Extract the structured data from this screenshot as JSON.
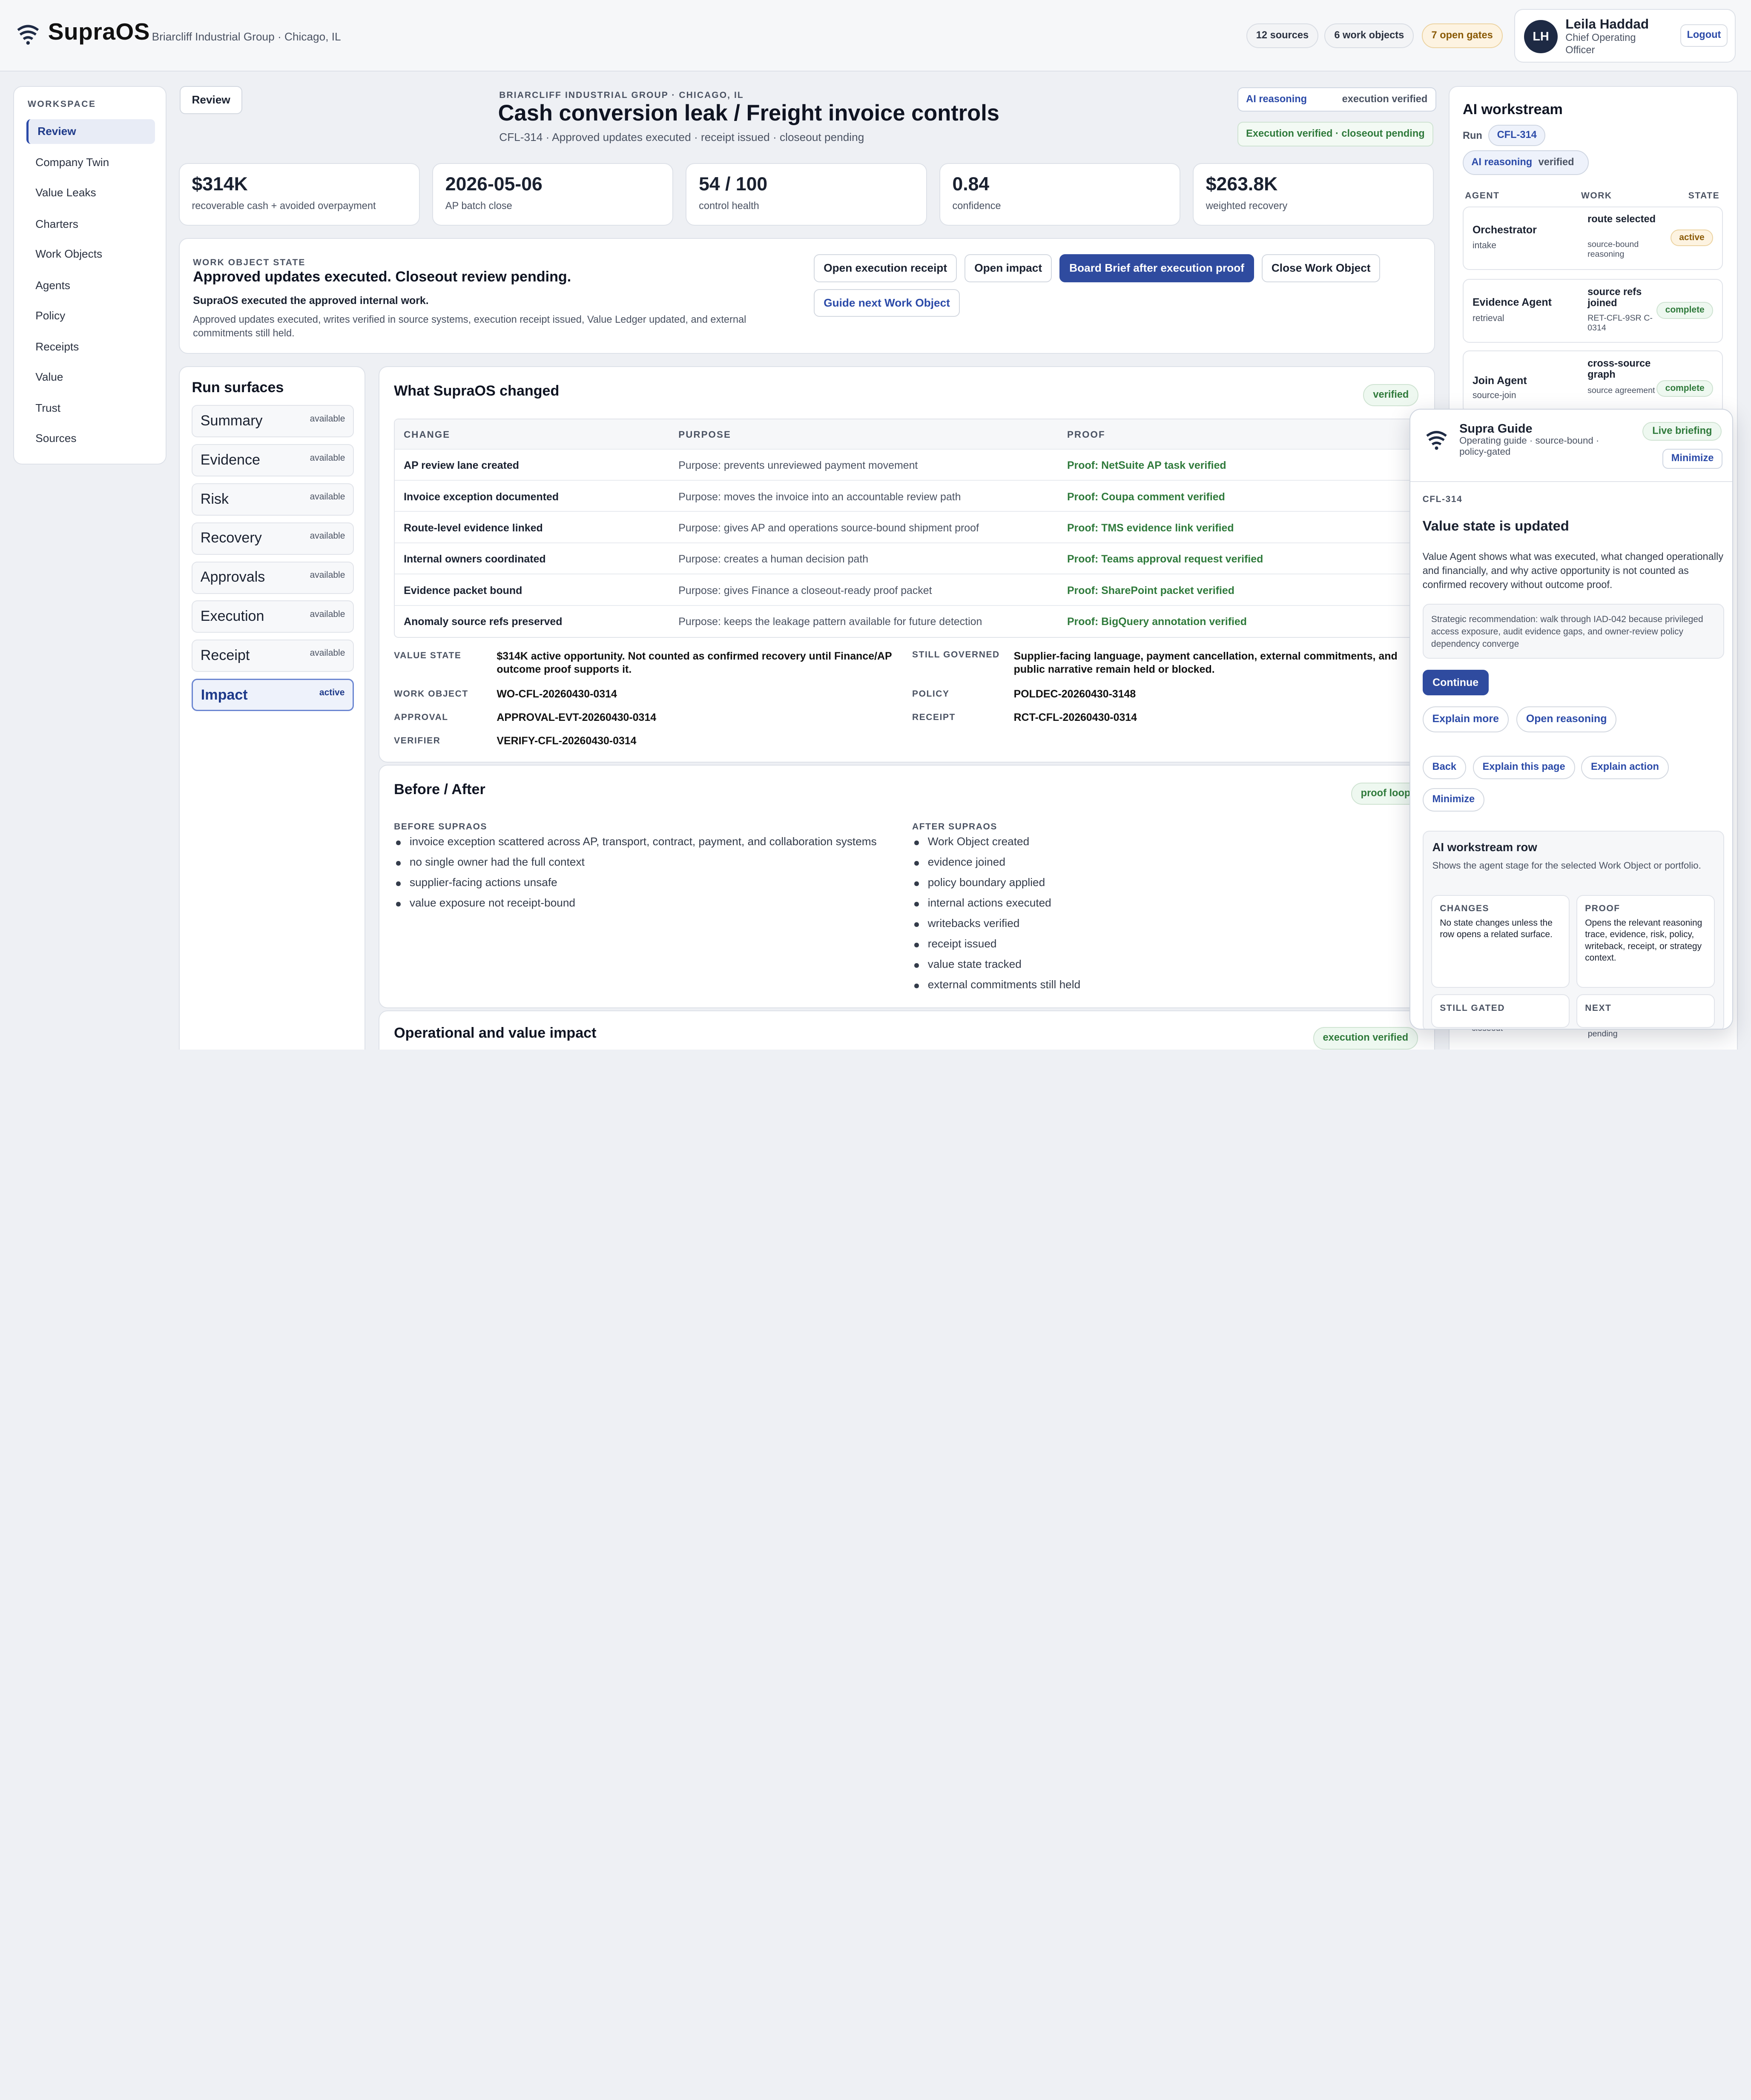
{
  "app": {
    "brand": "SupraOS",
    "tenant": "Briarcliff Industrial Group · Chicago, IL",
    "pills": [
      "12 sources",
      "6 work objects",
      "7 open gates"
    ],
    "user": {
      "initials": "LH",
      "name": "Leila Haddad",
      "role": "Chief Operating Officer",
      "logout": "Logout"
    }
  },
  "sidebar": {
    "heading": "WORKSPACE",
    "items": [
      "Review",
      "Company Twin",
      "Value Leaks",
      "Charters",
      "Work Objects",
      "Agents",
      "Policy",
      "Receipts",
      "Value",
      "Trust",
      "Sources"
    ],
    "active": "Review"
  },
  "header": {
    "review_button": "Review",
    "eyebrow": "BRIARCLIFF INDUSTRIAL GROUP · CHICAGO, IL",
    "title": "Cash conversion leak / Freight invoice controls",
    "subtitle": "CFL-314 · Approved updates executed · receipt issued · closeout pending",
    "tag_ai": "AI reasoning",
    "tag_exec": "execution verified",
    "tag_closeout": "Execution verified · closeout pending"
  },
  "kpis": [
    {
      "value": "$314K",
      "label": "recoverable cash + avoided overpayment"
    },
    {
      "value": "2026-05-06",
      "label": "AP batch close"
    },
    {
      "value": "54 / 100",
      "label": "control health"
    },
    {
      "value": "0.84",
      "label": "confidence"
    },
    {
      "value": "$263.8K",
      "label": "weighted recovery"
    }
  ],
  "work_object_state": {
    "eyebrow": "WORK OBJECT STATE",
    "title": "Approved updates executed. Closeout review pending.",
    "lead": "SupraOS executed the approved internal work.",
    "body": "Approved updates executed, writes verified in source systems, execution receipt issued, Value Ledger updated, and external commitments still held.",
    "buttons": {
      "open_receipt": "Open execution receipt",
      "open_impact": "Open impact",
      "board_brief": "Board Brief after execution proof",
      "close_wo": "Close Work Object",
      "guide_next": "Guide next Work Object"
    }
  },
  "run_surfaces": {
    "title": "Run surfaces",
    "items": [
      {
        "name": "Summary",
        "status": "available"
      },
      {
        "name": "Evidence",
        "status": "available"
      },
      {
        "name": "Risk",
        "status": "available"
      },
      {
        "name": "Recovery",
        "status": "available"
      },
      {
        "name": "Approvals",
        "status": "available"
      },
      {
        "name": "Execution",
        "status": "available"
      },
      {
        "name": "Receipt",
        "status": "available"
      },
      {
        "name": "Impact",
        "status": "active"
      }
    ]
  },
  "changed": {
    "title": "What SupraOS changed",
    "badge": "verified",
    "columns": [
      "CHANGE",
      "PURPOSE",
      "PROOF"
    ],
    "rows": [
      {
        "change": "AP review lane created",
        "purpose": "Purpose: prevents unreviewed payment movement",
        "proof": "Proof: NetSuite AP task verified"
      },
      {
        "change": "Invoice exception documented",
        "purpose": "Purpose: moves the invoice into an accountable review path",
        "proof": "Proof: Coupa comment verified"
      },
      {
        "change": "Route-level evidence linked",
        "purpose": "Purpose: gives AP and operations source-bound shipment proof",
        "proof": "Proof: TMS evidence link verified"
      },
      {
        "change": "Internal owners coordinated",
        "purpose": "Purpose: creates a human decision path",
        "proof": "Proof: Teams approval request verified"
      },
      {
        "change": "Evidence packet bound",
        "purpose": "Purpose: gives Finance a closeout-ready proof packet",
        "proof": "Proof: SharePoint packet verified"
      },
      {
        "change": "Anomaly source refs preserved",
        "purpose": "Purpose: keeps the leakage pattern available for future detection",
        "proof": "Proof: BigQuery annotation verified"
      }
    ],
    "kv": {
      "value_state_k": "VALUE STATE",
      "value_state_v": "$314K active opportunity. Not counted as confirmed recovery until Finance/AP outcome proof supports it.",
      "still_governed_k": "STILL GOVERNED",
      "still_governed_v": "Supplier-facing language, payment cancellation, external commitments, and public narrative remain held or blocked.",
      "work_object_k": "WORK OBJECT",
      "work_object_v": "WO-CFL-20260430-0314",
      "policy_k": "POLICY",
      "policy_v": "POLDEC-20260430-3148",
      "approval_k": "APPROVAL",
      "approval_v": "APPROVAL-EVT-20260430-0314",
      "receipt_k": "RECEIPT",
      "receipt_v": "RCT-CFL-20260430-0314",
      "verifier_k": "VERIFIER",
      "verifier_v": "VERIFY-CFL-20260430-0314"
    }
  },
  "before_after": {
    "title": "Before / After",
    "badge": "proof loop",
    "before_label": "BEFORE SUPRAOS",
    "before": [
      "invoice exception scattered across AP, transport, contract, payment, and collaboration systems",
      "no single owner had the full context",
      "supplier-facing actions unsafe",
      "value exposure not receipt-bound"
    ],
    "after_label": "AFTER SUPRAOS",
    "after": [
      "Work Object created",
      "evidence joined",
      "policy boundary applied",
      "internal actions executed",
      "writebacks verified",
      "receipt issued",
      "value state tracked",
      "external commitments still held"
    ]
  },
  "operational": {
    "title": "Operational and value impact",
    "badge": "execution verified"
  },
  "ai_workstream": {
    "title": "AI workstream",
    "run_label": "Run",
    "run_id": "CFL-314",
    "reasoning_label": "AI reasoning",
    "reasoning_state": "verified",
    "columns": [
      "AGENT",
      "WORK",
      "STATE"
    ],
    "agents": [
      {
        "name": "Orchestrator",
        "role": "intake",
        "work": "route selected",
        "detail": "source-bound reasoning",
        "state": "active"
      },
      {
        "name": "Evidence Agent",
        "role": "retrieval",
        "work": "source refs joined",
        "detail": "RET-CFL-9SR C-0314",
        "state": "complete"
      },
      {
        "name": "Join Agent",
        "role": "source-join",
        "work": "cross-source graph",
        "detail": "source agreement",
        "state": "complete"
      }
    ],
    "peek_left": "closeout",
    "peek_right": "pending"
  },
  "guide": {
    "title": "Supra Guide",
    "subtitle": "Operating guide · source-bound · policy-gated",
    "live": "Live briefing",
    "minimize": "Minimize",
    "run_id": "CFL-314",
    "heading": "Value state is updated",
    "body": "Value Agent shows what was executed, what changed operationally and financially, and why active opportunity is not counted as confirmed recovery without outcome proof.",
    "recommendation": "Strategic recommendation: walk through IAD-042 because privileged access exposure, audit evidence gaps, and owner-review policy dependency converge",
    "continue": "Continue",
    "explain_more": "Explain more",
    "open_reasoning": "Open reasoning",
    "back": "Back",
    "explain_page": "Explain this page",
    "explain_action": "Explain action",
    "minimize2": "Minimize",
    "row_title": "AI workstream row",
    "row_desc": "Shows the agent stage for the selected Work Object or portfolio.",
    "changes_k": "CHANGES",
    "changes_v": "No state changes unless the row opens a related surface.",
    "proof_k": "PROOF",
    "proof_v": "Opens the relevant reasoning trace, evidence, risk, policy, writeback, receipt, or strategy context.",
    "gated_k": "STILL GATED",
    "next_k": "NEXT"
  }
}
